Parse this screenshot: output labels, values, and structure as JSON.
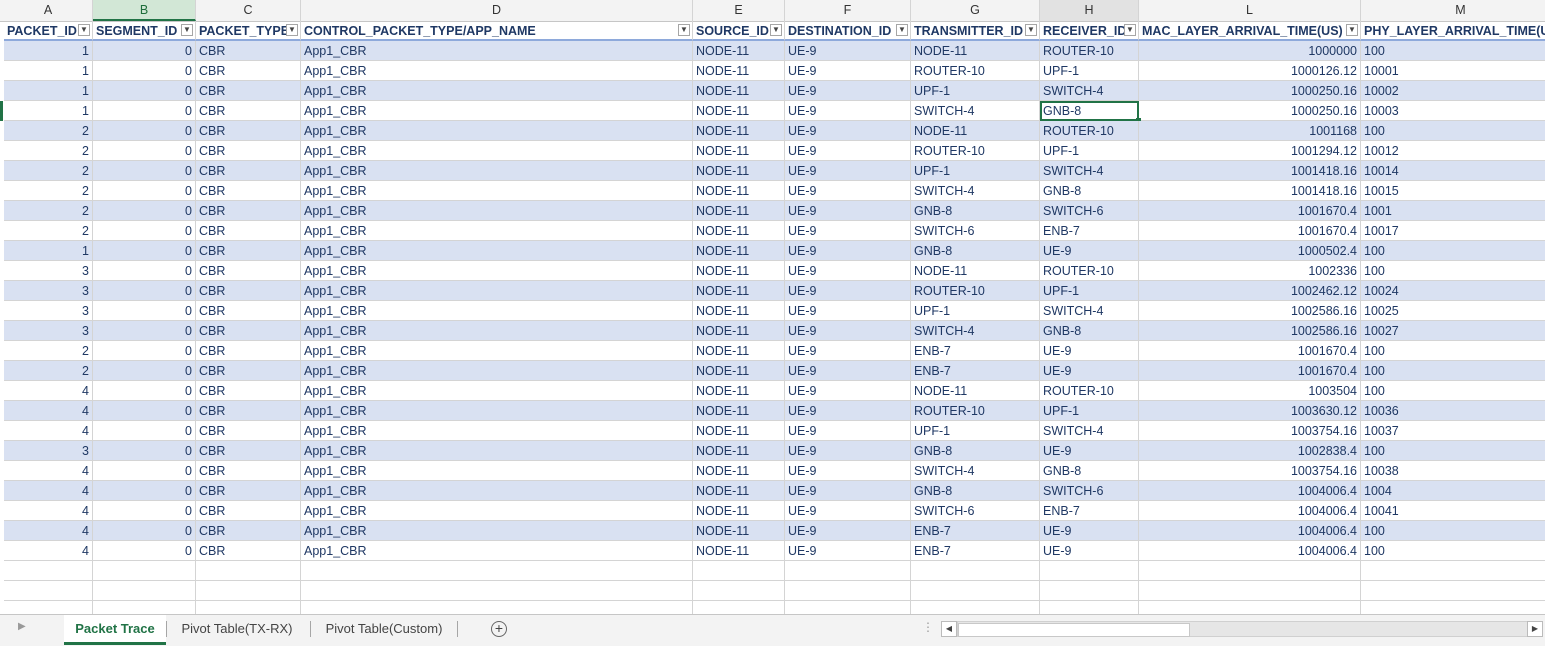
{
  "sheet": {
    "column_letters": [
      "A",
      "B",
      "C",
      "D",
      "E",
      "F",
      "G",
      "H",
      "L",
      "M"
    ],
    "headers": [
      "PACKET_ID",
      "SEGMENT_ID",
      "PACKET_TYPE",
      "CONTROL_PACKET_TYPE/APP_NAME",
      "SOURCE_ID",
      "DESTINATION_ID",
      "TRANSMITTER_ID",
      "RECEIVER_ID",
      "MAC_LAYER_ARRIVAL_TIME(US)",
      "PHY_LAYER_ARRIVAL_TIME(US)"
    ],
    "rows": [
      [
        "1",
        "0",
        "CBR",
        "App1_CBR",
        "NODE-11",
        "UE-9",
        "NODE-11",
        "ROUTER-10",
        "1000000",
        "100"
      ],
      [
        "1",
        "0",
        "CBR",
        "App1_CBR",
        "NODE-11",
        "UE-9",
        "ROUTER-10",
        "UPF-1",
        "1000126.12",
        "10001"
      ],
      [
        "1",
        "0",
        "CBR",
        "App1_CBR",
        "NODE-11",
        "UE-9",
        "UPF-1",
        "SWITCH-4",
        "1000250.16",
        "10002"
      ],
      [
        "1",
        "0",
        "CBR",
        "App1_CBR",
        "NODE-11",
        "UE-9",
        "SWITCH-4",
        "GNB-8",
        "1000250.16",
        "10003"
      ],
      [
        "2",
        "0",
        "CBR",
        "App1_CBR",
        "NODE-11",
        "UE-9",
        "NODE-11",
        "ROUTER-10",
        "1001168",
        "100"
      ],
      [
        "2",
        "0",
        "CBR",
        "App1_CBR",
        "NODE-11",
        "UE-9",
        "ROUTER-10",
        "UPF-1",
        "1001294.12",
        "10012"
      ],
      [
        "2",
        "0",
        "CBR",
        "App1_CBR",
        "NODE-11",
        "UE-9",
        "UPF-1",
        "SWITCH-4",
        "1001418.16",
        "10014"
      ],
      [
        "2",
        "0",
        "CBR",
        "App1_CBR",
        "NODE-11",
        "UE-9",
        "SWITCH-4",
        "GNB-8",
        "1001418.16",
        "10015"
      ],
      [
        "2",
        "0",
        "CBR",
        "App1_CBR",
        "NODE-11",
        "UE-9",
        "GNB-8",
        "SWITCH-6",
        "1001670.4",
        "1001"
      ],
      [
        "2",
        "0",
        "CBR",
        "App1_CBR",
        "NODE-11",
        "UE-9",
        "SWITCH-6",
        "ENB-7",
        "1001670.4",
        "10017"
      ],
      [
        "1",
        "0",
        "CBR",
        "App1_CBR",
        "NODE-11",
        "UE-9",
        "GNB-8",
        "UE-9",
        "1000502.4",
        "100"
      ],
      [
        "3",
        "0",
        "CBR",
        "App1_CBR",
        "NODE-11",
        "UE-9",
        "NODE-11",
        "ROUTER-10",
        "1002336",
        "100"
      ],
      [
        "3",
        "0",
        "CBR",
        "App1_CBR",
        "NODE-11",
        "UE-9",
        "ROUTER-10",
        "UPF-1",
        "1002462.12",
        "10024"
      ],
      [
        "3",
        "0",
        "CBR",
        "App1_CBR",
        "NODE-11",
        "UE-9",
        "UPF-1",
        "SWITCH-4",
        "1002586.16",
        "10025"
      ],
      [
        "3",
        "0",
        "CBR",
        "App1_CBR",
        "NODE-11",
        "UE-9",
        "SWITCH-4",
        "GNB-8",
        "1002586.16",
        "10027"
      ],
      [
        "2",
        "0",
        "CBR",
        "App1_CBR",
        "NODE-11",
        "UE-9",
        "ENB-7",
        "UE-9",
        "1001670.4",
        "100"
      ],
      [
        "2",
        "0",
        "CBR",
        "App1_CBR",
        "NODE-11",
        "UE-9",
        "ENB-7",
        "UE-9",
        "1001670.4",
        "100"
      ],
      [
        "4",
        "0",
        "CBR",
        "App1_CBR",
        "NODE-11",
        "UE-9",
        "NODE-11",
        "ROUTER-10",
        "1003504",
        "100"
      ],
      [
        "4",
        "0",
        "CBR",
        "App1_CBR",
        "NODE-11",
        "UE-9",
        "ROUTER-10",
        "UPF-1",
        "1003630.12",
        "10036"
      ],
      [
        "4",
        "0",
        "CBR",
        "App1_CBR",
        "NODE-11",
        "UE-9",
        "UPF-1",
        "SWITCH-4",
        "1003754.16",
        "10037"
      ],
      [
        "3",
        "0",
        "CBR",
        "App1_CBR",
        "NODE-11",
        "UE-9",
        "GNB-8",
        "UE-9",
        "1002838.4",
        "100"
      ],
      [
        "4",
        "0",
        "CBR",
        "App1_CBR",
        "NODE-11",
        "UE-9",
        "SWITCH-4",
        "GNB-8",
        "1003754.16",
        "10038"
      ],
      [
        "4",
        "0",
        "CBR",
        "App1_CBR",
        "NODE-11",
        "UE-9",
        "GNB-8",
        "SWITCH-6",
        "1004006.4",
        "1004"
      ],
      [
        "4",
        "0",
        "CBR",
        "App1_CBR",
        "NODE-11",
        "UE-9",
        "SWITCH-6",
        "ENB-7",
        "1004006.4",
        "10041"
      ],
      [
        "4",
        "0",
        "CBR",
        "App1_CBR",
        "NODE-11",
        "UE-9",
        "ENB-7",
        "UE-9",
        "1004006.4",
        "100"
      ],
      [
        "4",
        "0",
        "CBR",
        "App1_CBR",
        "NODE-11",
        "UE-9",
        "ENB-7",
        "UE-9",
        "1004006.4",
        "100"
      ]
    ],
    "filter_icons": [
      "filter-active-icon",
      "dropdown-icon",
      "dropdown-icon",
      "filter-active-icon",
      "dropdown-icon",
      "dropdown-icon",
      "dropdown-icon",
      "dropdown-icon",
      "dropdown-icon",
      "dropdown-icon"
    ],
    "selected_column": "B",
    "highlighted_column": "H",
    "active_cell": "H5"
  },
  "tabs": {
    "items": [
      "Packet Trace",
      "Pivot Table(TX-RX)",
      "Pivot Table(Custom)"
    ],
    "active": "Packet Trace"
  },
  "colors": {
    "band": "#d9e1f2",
    "text": "#1f3864",
    "accent": "#217346"
  }
}
